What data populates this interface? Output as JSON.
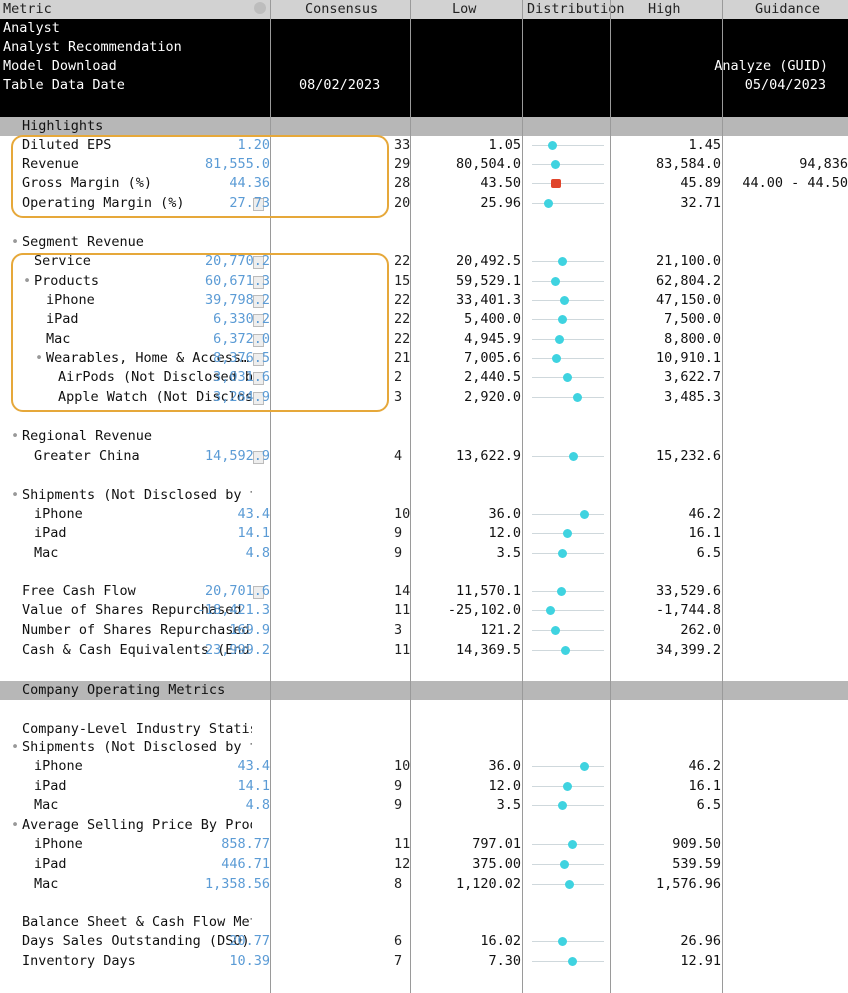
{
  "header": {
    "metric": "Metric",
    "consensus": "Consensus",
    "low": "Low",
    "distribution": "Distribution",
    "high": "High",
    "guidance": "Guidance"
  },
  "info_rows": [
    {
      "label": "Analyst",
      "consensus": "",
      "guidance": ""
    },
    {
      "label": "Analyst Recommendation",
      "consensus": "",
      "guidance": ""
    },
    {
      "label": "Model Download",
      "consensus": "",
      "guidance": "Analyze (GUID)"
    },
    {
      "label": "Table Data Date",
      "consensus": "08/02/2023",
      "guidance": "05/04/2023"
    }
  ],
  "sections": {
    "highlights": "Highlights",
    "company_operating_metrics": "Company Operating Metrics"
  },
  "rows": [
    {
      "label": "Diluted EPS",
      "indent": 1,
      "consensus": "1.20",
      "count": "33",
      "low": "1.05",
      "high": "1.45",
      "guidance": "",
      "dist": 0.28,
      "color": "cyan",
      "doc": false
    },
    {
      "label": "Revenue",
      "indent": 1,
      "consensus": "81,555.0",
      "count": "29",
      "low": "80,504.0",
      "high": "83,584.0",
      "guidance": "94,836",
      "dist": 0.32,
      "color": "cyan",
      "doc": false
    },
    {
      "label": "Gross Margin (%)",
      "indent": 1,
      "consensus": "44.36",
      "count": "28",
      "low": "43.50",
      "high": "45.89",
      "guidance": "44.00 - 44.50",
      "dist": 0.32,
      "color": "red",
      "doc": false
    },
    {
      "label": "Operating Margin (%)",
      "indent": 1,
      "consensus": "27.73",
      "count": "20",
      "low": "25.96",
      "high": "32.71",
      "guidance": "",
      "dist": 0.22,
      "color": "cyan",
      "doc": true
    },
    {
      "label": "Segment Revenue",
      "indent": 1,
      "bullet": true,
      "consensus": "",
      "count": "",
      "low": "",
      "high": "",
      "guidance": "",
      "dist": null,
      "doc": false
    },
    {
      "label": "Service",
      "indent": 2,
      "consensus": "20,770.2",
      "count": "22",
      "low": "20,492.5",
      "high": "21,100.0",
      "guidance": "",
      "dist": 0.42,
      "color": "cyan",
      "doc": true
    },
    {
      "label": "Products",
      "indent": 2,
      "bullet": true,
      "consensus": "60,671.3",
      "count": "15",
      "low": "59,529.1",
      "high": "62,804.2",
      "guidance": "",
      "dist": 0.32,
      "color": "cyan",
      "doc": true
    },
    {
      "label": "iPhone",
      "indent": 3,
      "consensus": "39,798.2",
      "count": "22",
      "low": "33,401.3",
      "high": "47,150.0",
      "guidance": "",
      "dist": 0.45,
      "color": "cyan",
      "doc": true
    },
    {
      "label": "iPad",
      "indent": 3,
      "consensus": "6,330.2",
      "count": "22",
      "low": "5,400.0",
      "high": "7,500.0",
      "guidance": "",
      "dist": 0.42,
      "color": "cyan",
      "doc": true
    },
    {
      "label": "Mac",
      "indent": 3,
      "consensus": "6,372.0",
      "count": "22",
      "low": "4,945.9",
      "high": "8,800.0",
      "guidance": "",
      "dist": 0.38,
      "color": "cyan",
      "doc": true
    },
    {
      "label": "Wearables, Home & Access…",
      "indent": 3,
      "bullet": true,
      "consensus": "8,376.5",
      "count": "21",
      "low": "7,005.6",
      "high": "10,910.1",
      "guidance": "",
      "dist": 0.34,
      "color": "cyan",
      "doc": true
    },
    {
      "label": "AirPods (Not Disclosed b…",
      "indent": 4,
      "consensus": "3,031.6",
      "count": "2",
      "low": "2,440.5",
      "high": "3,622.7",
      "guidance": "",
      "dist": 0.48,
      "color": "cyan",
      "doc": true
    },
    {
      "label": "Apple Watch (Not Disclos…",
      "indent": 4,
      "consensus": "3,284.9",
      "count": "3",
      "low": "2,920.0",
      "high": "3,485.3",
      "guidance": "",
      "dist": 0.63,
      "color": "cyan",
      "doc": true
    },
    {
      "label": "Regional Revenue",
      "indent": 1,
      "bullet": true,
      "consensus": "",
      "count": "",
      "low": "",
      "high": "",
      "guidance": "",
      "dist": null,
      "doc": false
    },
    {
      "label": "Greater China",
      "indent": 2,
      "consensus": "14,592.9",
      "count": "4",
      "low": "13,622.9",
      "high": "15,232.6",
      "guidance": "",
      "dist": 0.57,
      "color": "cyan",
      "doc": true
    },
    {
      "label": "Shipments (Not Disclosed by t…",
      "indent": 1,
      "bullet": true,
      "consensus": "",
      "count": "",
      "low": "",
      "high": "",
      "guidance": "",
      "dist": null,
      "doc": false
    },
    {
      "label": "iPhone",
      "indent": 2,
      "consensus": "43.4",
      "count": "10",
      "low": "36.0",
      "high": "46.2",
      "guidance": "",
      "dist": 0.72,
      "color": "cyan",
      "doc": false
    },
    {
      "label": "iPad",
      "indent": 2,
      "consensus": "14.1",
      "count": "9",
      "low": "12.0",
      "high": "16.1",
      "guidance": "",
      "dist": 0.48,
      "color": "cyan",
      "doc": false
    },
    {
      "label": "Mac",
      "indent": 2,
      "consensus": "4.8",
      "count": "9",
      "low": "3.5",
      "high": "6.5",
      "guidance": "",
      "dist": 0.42,
      "color": "cyan",
      "doc": false
    },
    {
      "label": "Free Cash Flow",
      "indent": 1,
      "consensus": "20,701.6",
      "count": "14",
      "low": "11,570.1",
      "high": "33,529.6",
      "guidance": "",
      "dist": 0.4,
      "color": "cyan",
      "doc": true
    },
    {
      "label": "Value of Shares Repurchased",
      "indent": 1,
      "consensus": "-18,421.3",
      "count": "11",
      "low": "-25,102.0",
      "high": "-1,744.8",
      "guidance": "",
      "dist": 0.25,
      "color": "cyan",
      "doc": false
    },
    {
      "label": "Number of Shares Repurchased",
      "indent": 1,
      "consensus": "169.9",
      "count": "3",
      "low": "121.2",
      "high": "262.0",
      "guidance": "",
      "dist": 0.32,
      "color": "cyan",
      "doc": false
    },
    {
      "label": "Cash & Cash Equivalents (End …",
      "indent": 1,
      "consensus": "23,999.2",
      "count": "11",
      "low": "14,369.5",
      "high": "34,399.2",
      "guidance": "",
      "dist": 0.46,
      "color": "cyan",
      "doc": false
    },
    {
      "label": "Company-Level Industry Statis…",
      "indent": 1,
      "consensus": "",
      "count": "",
      "low": "",
      "high": "",
      "guidance": "",
      "dist": null,
      "doc": false
    },
    {
      "label": "Shipments (Not Disclosed by t…",
      "indent": 1,
      "bullet": true,
      "consensus": "",
      "count": "",
      "low": "",
      "high": "",
      "guidance": "",
      "dist": null,
      "doc": false
    },
    {
      "label": "iPhone",
      "indent": 2,
      "consensus": "43.4",
      "count": "10",
      "low": "36.0",
      "high": "46.2",
      "guidance": "",
      "dist": 0.72,
      "color": "cyan",
      "doc": false
    },
    {
      "label": "iPad",
      "indent": 2,
      "consensus": "14.1",
      "count": "9",
      "low": "12.0",
      "high": "16.1",
      "guidance": "",
      "dist": 0.48,
      "color": "cyan",
      "doc": false
    },
    {
      "label": "Mac",
      "indent": 2,
      "consensus": "4.8",
      "count": "9",
      "low": "3.5",
      "high": "6.5",
      "guidance": "",
      "dist": 0.42,
      "color": "cyan",
      "doc": false
    },
    {
      "label": "Average Selling Price By Prod…",
      "indent": 1,
      "bullet": true,
      "consensus": "",
      "count": "",
      "low": "",
      "high": "",
      "guidance": "",
      "dist": null,
      "doc": false
    },
    {
      "label": "iPhone",
      "indent": 2,
      "consensus": "858.77",
      "count": "11",
      "low": "797.01",
      "high": "909.50",
      "guidance": "",
      "dist": 0.55,
      "color": "cyan",
      "doc": false
    },
    {
      "label": "iPad",
      "indent": 2,
      "consensus": "446.71",
      "count": "12",
      "low": "375.00",
      "high": "539.59",
      "guidance": "",
      "dist": 0.44,
      "color": "cyan",
      "doc": false
    },
    {
      "label": "Mac",
      "indent": 2,
      "consensus": "1,358.56",
      "count": "8",
      "low": "1,120.02",
      "high": "1,576.96",
      "guidance": "",
      "dist": 0.52,
      "color": "cyan",
      "doc": false
    },
    {
      "label": "Balance Sheet & Cash Flow Met…",
      "indent": 1,
      "consensus": "",
      "count": "",
      "low": "",
      "high": "",
      "guidance": "",
      "dist": null,
      "doc": false
    },
    {
      "label": "Days Sales Outstanding (DSO)",
      "indent": 1,
      "consensus": "20.77",
      "count": "6",
      "low": "16.02",
      "high": "26.96",
      "guidance": "",
      "dist": 0.42,
      "color": "cyan",
      "doc": false
    },
    {
      "label": "Inventory Days",
      "indent": 1,
      "consensus": "10.39",
      "count": "7",
      "low": "7.30",
      "high": "12.91",
      "guidance": "",
      "dist": 0.55,
      "color": "cyan",
      "doc": false
    }
  ],
  "colors": {
    "consensus": "#5b9bd5",
    "dot": "#3fd3e0",
    "dot_alt": "#e0452b",
    "highlight_box": "#e6a83a",
    "section_bg": "#b7b7b7"
  }
}
